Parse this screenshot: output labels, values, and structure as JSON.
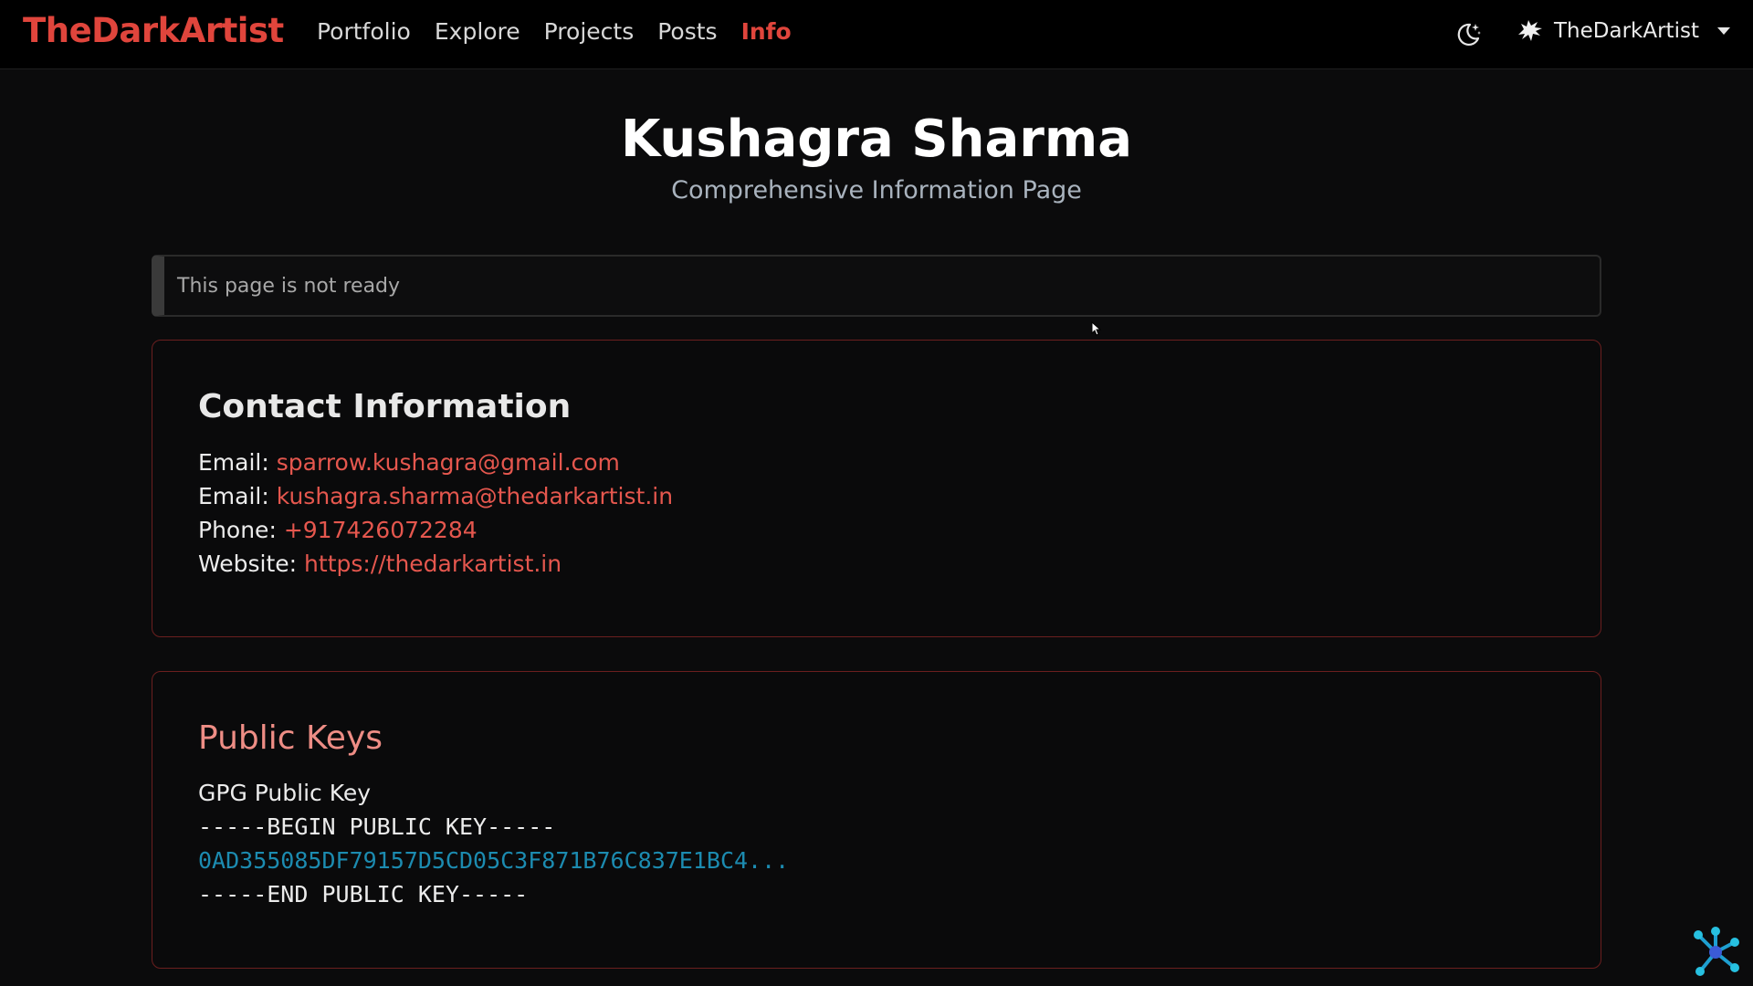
{
  "nav": {
    "brand": "TheDarkArtist",
    "links": [
      "Portfolio",
      "Explore",
      "Projects",
      "Posts",
      "Info"
    ],
    "active": "Info",
    "user": "TheDarkArtist"
  },
  "header": {
    "title": "Kushagra Sharma",
    "subtitle": "Comprehensive Information Page"
  },
  "notice": {
    "text": "This page is not ready"
  },
  "contact": {
    "title": "Contact Information",
    "lines": [
      {
        "label": "Email:",
        "value": "sparrow.kushagra@gmail.com"
      },
      {
        "label": "Email:",
        "value": "kushagra.sharma@thedarkartist.in"
      },
      {
        "label": "Phone:",
        "value": "+917426072284"
      },
      {
        "label": "Website:",
        "value": "https://thedarkartist.in"
      }
    ]
  },
  "keys": {
    "title": "Public Keys",
    "gpg_label": "GPG Public Key",
    "begin": "-----BEGIN PUBLIC KEY-----",
    "hash": "0AD355085DF79157D5CD05C3F871B76C837E1BC4...",
    "end": "-----END PUBLIC KEY-----"
  },
  "colors": {
    "accent": "#e0453c",
    "link": "#e5574e",
    "hash": "#1c8bb0",
    "card_border": "#6b1f1f",
    "background": "#0b0b0c"
  },
  "icons": {
    "theme": "moon-stars-icon",
    "user": "wolf-avatar-icon",
    "dropdown": "caret-down-icon",
    "widget": "network-nodes-icon"
  }
}
